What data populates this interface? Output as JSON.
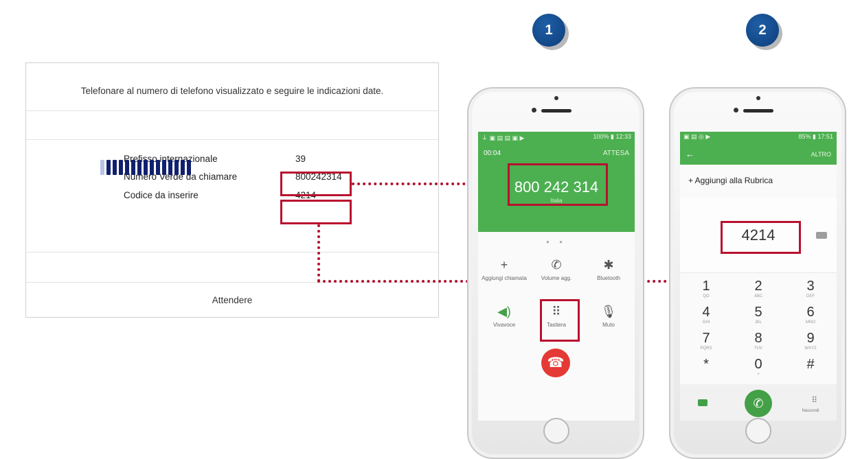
{
  "web": {
    "instruction": "Telefonare al numero di telefono visualizzato e seguire le indicazioni date.",
    "rows": [
      {
        "label": "Prefisso internazionale",
        "value": "39"
      },
      {
        "label": "Numero Verde da chiamare",
        "value": "800242314"
      },
      {
        "label": "Codice da inserire",
        "value": "4214"
      }
    ],
    "progress": {
      "filled_segments": 14,
      "light_segments": 1
    },
    "wait_text": "Attendere"
  },
  "badges": {
    "step1": "1",
    "step2": "2"
  },
  "phone1": {
    "status_left": "⏚ ▣ ▤ ▤ ▣ ▶",
    "status_right": "100% ▮ 12:33",
    "timer": "00:04",
    "hold": "ATTESA",
    "number": "800 242 314",
    "country": "Italia",
    "actions": [
      {
        "icon": "+",
        "label": "Aggiungi chiamata"
      },
      {
        "icon": "✆",
        "label": "Volume agg."
      },
      {
        "icon": "✱",
        "label": "Bluetooth"
      },
      {
        "icon": "◀)",
        "label": "Vivavoce"
      },
      {
        "icon": "⠿",
        "label": "Tastiera"
      },
      {
        "icon": "🎙",
        "label": "Muto"
      }
    ]
  },
  "phone2": {
    "status_left": "▣ ▤ ◎ ▶",
    "status_right": "85% ▮ 17:51",
    "back": "←",
    "more": "ALTRO",
    "add_contact": "+  Aggiungi alla Rubrica",
    "display": "4214",
    "keys": [
      {
        "d": "1",
        "l": "QO"
      },
      {
        "d": "2",
        "l": "ABC"
      },
      {
        "d": "3",
        "l": "DEF"
      },
      {
        "d": "4",
        "l": "GHI"
      },
      {
        "d": "5",
        "l": "JKL"
      },
      {
        "d": "6",
        "l": "MNO"
      },
      {
        "d": "7",
        "l": "PQRS"
      },
      {
        "d": "8",
        "l": "TUV"
      },
      {
        "d": "9",
        "l": "WXYZ"
      },
      {
        "d": "*",
        "l": ""
      },
      {
        "d": "0",
        "l": "+"
      },
      {
        "d": "#",
        "l": ""
      }
    ],
    "hide_label": "Nascondi"
  }
}
